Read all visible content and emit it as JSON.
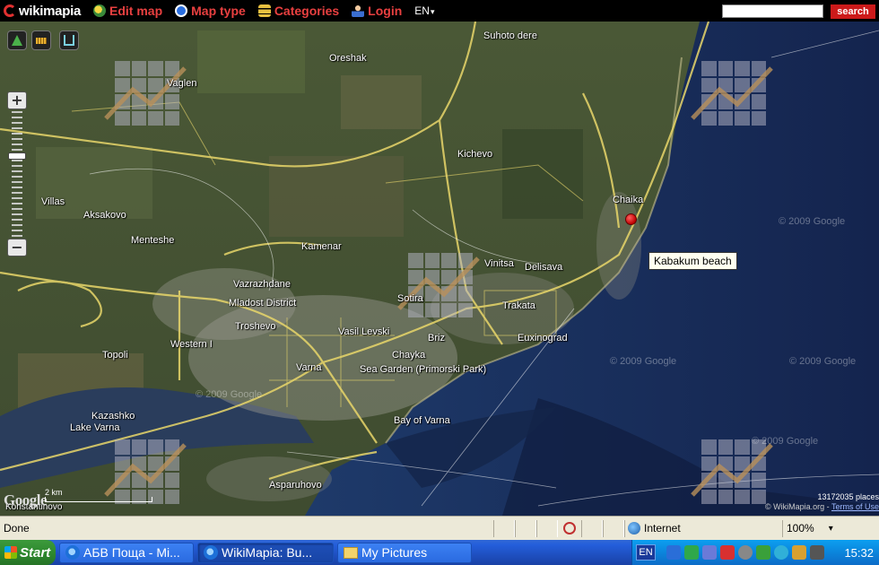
{
  "toolbar": {
    "logo": "wikimapia",
    "edit_map": "Edit map",
    "map_type": "Map type",
    "categories": "Categories",
    "login": "Login",
    "lang": "EN",
    "search_value": "",
    "search_button": "search"
  },
  "map": {
    "labels": [
      {
        "text": "Suhoto dere"
      },
      {
        "text": "Oreshak"
      },
      {
        "text": "Vaglen"
      },
      {
        "text": "Kichevo"
      },
      {
        "text": "Chaika"
      },
      {
        "text": "Villas"
      },
      {
        "text": "Aksakovo"
      },
      {
        "text": "Menteshe"
      },
      {
        "text": "Kamenar"
      },
      {
        "text": "Vinitsa"
      },
      {
        "text": "Delisava"
      },
      {
        "text": "Vazrazhdane"
      },
      {
        "text": "Mladost District"
      },
      {
        "text": "Sotira"
      },
      {
        "text": "Trakata"
      },
      {
        "text": "Troshevo"
      },
      {
        "text": "Vasil Levski"
      },
      {
        "text": "Euxinograd"
      },
      {
        "text": "Western I"
      },
      {
        "text": "Briz"
      },
      {
        "text": "Topoli"
      },
      {
        "text": "Chayka"
      },
      {
        "text": "Varna"
      },
      {
        "text": "Sea Garden (Primorski Park)"
      },
      {
        "text": "Bay of Varna"
      },
      {
        "text": "Kazashko"
      },
      {
        "text": "Lake Varna"
      },
      {
        "text": "Asparuhovo"
      },
      {
        "text": "Konstantinovo"
      }
    ],
    "watermarks": [
      "© 2009 Google",
      "© 2009 Google",
      "© 2009 Google",
      "© 2009 Google",
      "© 2009 Google"
    ],
    "tooltip": "Kabakum beach",
    "place_count": "13172035 places",
    "copyright_prefix": "© WikiMapia.org - ",
    "terms_link": "Terms of Use",
    "google_logo": "Google",
    "scale_label": "2 km"
  },
  "statusbar": {
    "status": "Done",
    "zone": "Internet",
    "zoom": "100%"
  },
  "taskbar": {
    "start": "Start",
    "tasks": [
      {
        "label": "АБВ Поща - Mi..."
      },
      {
        "label": "WikiMapia: Bu..."
      },
      {
        "label": "My Pictures"
      }
    ],
    "lang_indicator": "EN",
    "clock": "15:32"
  }
}
